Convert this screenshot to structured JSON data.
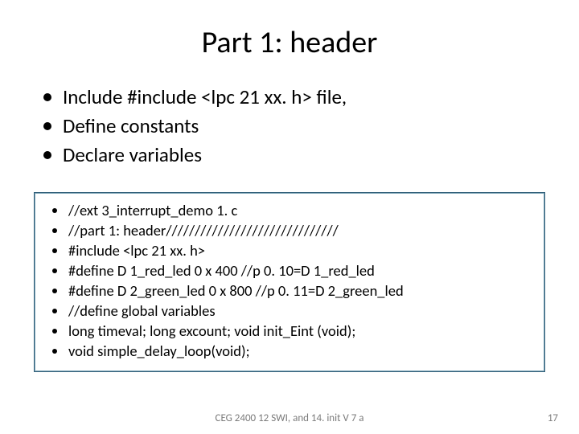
{
  "title": "Part 1: header",
  "intro": [
    "Include #include <lpc 21 xx. h> file,",
    "Define constants",
    "Declare variables"
  ],
  "code": [
    "//ext 3_interrupt_demo 1. c",
    "//part 1:   header//////////////////////////////",
    "#include <lpc 21 xx. h>",
    "#define D 1_red_led 0 x 400 //p 0. 10=D 1_red_led",
    "#define D 2_green_led 0 x 800 //p 0. 11=D 2_green_led",
    "//define global variables",
    "long timeval; long excount; void init_Eint (void);",
    "void simple_delay_loop(void);"
  ],
  "footer": "CEG 2400 12 SWI, and 14. init V 7 a",
  "page": "17"
}
